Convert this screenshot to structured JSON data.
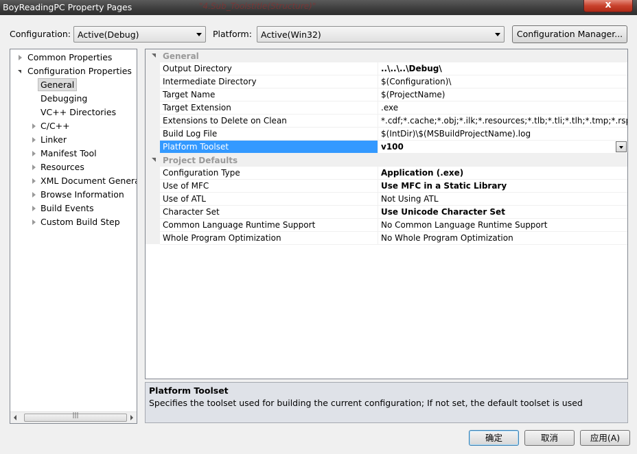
{
  "window": {
    "title": "BoyReadingPC Property Pages",
    "ghost_text": "\"4.Sub_Toolstitle(Structure)\"",
    "close_glyph": "x"
  },
  "toolbar": {
    "configuration_label": "Configuration:",
    "configuration_value": "Active(Debug)",
    "platform_label": "Platform:",
    "platform_value": "Active(Win32)",
    "config_manager_label": "Configuration Manager..."
  },
  "tree": {
    "items": [
      {
        "label": "Common Properties",
        "state": "collapsed"
      },
      {
        "label": "Configuration Properties",
        "state": "expanded"
      },
      {
        "label": "General",
        "state": "selected"
      },
      {
        "label": "Debugging",
        "state": "leaf"
      },
      {
        "label": "VC++ Directories",
        "state": "leaf"
      },
      {
        "label": "C/C++",
        "state": "collapsed"
      },
      {
        "label": "Linker",
        "state": "collapsed"
      },
      {
        "label": "Manifest Tool",
        "state": "collapsed"
      },
      {
        "label": "Resources",
        "state": "collapsed"
      },
      {
        "label": "XML Document Generat",
        "state": "collapsed"
      },
      {
        "label": "Browse Information",
        "state": "collapsed"
      },
      {
        "label": "Build Events",
        "state": "collapsed"
      },
      {
        "label": "Custom Build Step",
        "state": "collapsed"
      }
    ],
    "scroll_thumb_glyph": "|||"
  },
  "grid": {
    "categories": [
      {
        "name": "General",
        "properties": [
          {
            "name": "Output Directory",
            "value": "..\\..\\..\\Debug\\",
            "bold": true
          },
          {
            "name": "Intermediate Directory",
            "value": "$(Configuration)\\"
          },
          {
            "name": "Target Name",
            "value": "$(ProjectName)"
          },
          {
            "name": "Target Extension",
            "value": ".exe"
          },
          {
            "name": "Extensions to Delete on Clean",
            "value": "*.cdf;*.cache;*.obj;*.ilk;*.resources;*.tlb;*.tli;*.tlh;*.tmp;*.rsp;*.pgc"
          },
          {
            "name": "Build Log File",
            "value": "$(IntDir)\\$(MSBuildProjectName).log"
          },
          {
            "name": "Platform Toolset",
            "value": "v100",
            "bold": true,
            "selected": true
          }
        ]
      },
      {
        "name": "Project Defaults",
        "properties": [
          {
            "name": "Configuration Type",
            "value": "Application (.exe)",
            "bold": true
          },
          {
            "name": "Use of MFC",
            "value": "Use MFC in a Static Library",
            "bold": true
          },
          {
            "name": "Use of ATL",
            "value": "Not Using ATL"
          },
          {
            "name": "Character Set",
            "value": "Use Unicode Character Set",
            "bold": true
          },
          {
            "name": "Common Language Runtime Support",
            "value": "No Common Language Runtime Support"
          },
          {
            "name": "Whole Program Optimization",
            "value": "No Whole Program Optimization"
          }
        ]
      }
    ]
  },
  "description": {
    "title": "Platform Toolset",
    "text": "Specifies the toolset used for building the current configuration; If not set, the default toolset is used"
  },
  "buttons": {
    "ok": "确定",
    "cancel": "取消",
    "apply": "应用(A)"
  },
  "colors": {
    "selection": "#3399ff",
    "annotation_underline": "#e00000"
  }
}
